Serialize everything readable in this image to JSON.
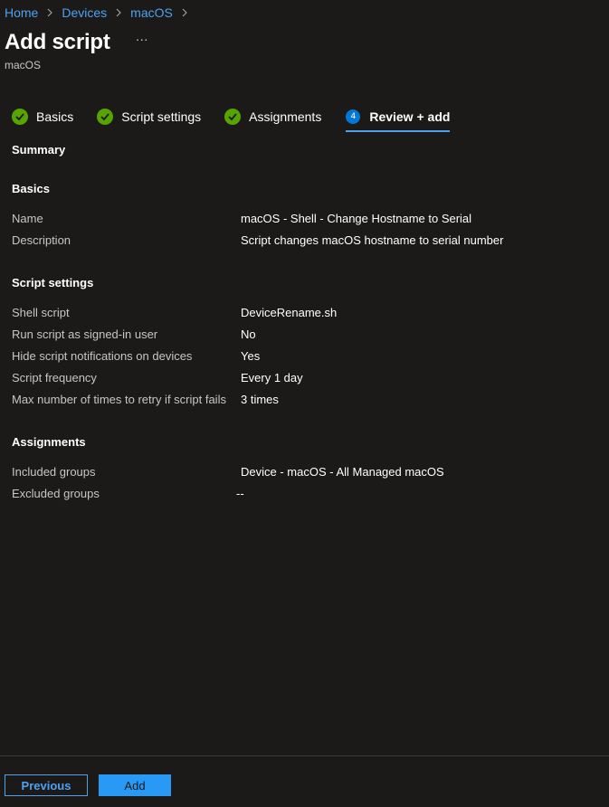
{
  "breadcrumb": {
    "items": [
      "Home",
      "Devices",
      "macOS"
    ]
  },
  "header": {
    "title": "Add script",
    "more": "···",
    "subtitle": "macOS"
  },
  "wizard": {
    "steps": [
      {
        "label": "Basics",
        "state": "complete"
      },
      {
        "label": "Script settings",
        "state": "complete"
      },
      {
        "label": "Assignments",
        "state": "complete"
      },
      {
        "label": "Review + add",
        "state": "active",
        "number": "4"
      }
    ]
  },
  "summary": {
    "heading": "Summary",
    "basics": {
      "heading": "Basics",
      "rows": [
        {
          "key": "Name",
          "value": "macOS - Shell - Change Hostname to Serial"
        },
        {
          "key": "Description",
          "value": "Script changes macOS hostname to serial number"
        }
      ]
    },
    "script_settings": {
      "heading": "Script settings",
      "rows": [
        {
          "key": "Shell script",
          "value": "DeviceRename.sh"
        },
        {
          "key": "Run script as signed-in user",
          "value": "No"
        },
        {
          "key": "Hide script notifications on devices",
          "value": "Yes"
        },
        {
          "key": "Script frequency",
          "value": "Every 1 day"
        },
        {
          "key": "Max number of times to retry if script fails",
          "value": "3 times"
        }
      ]
    },
    "assignments": {
      "heading": "Assignments",
      "rows": [
        {
          "key": "Included groups",
          "value": "Device - macOS - All Managed macOS"
        },
        {
          "key": "Excluded groups",
          "value": "--"
        }
      ]
    }
  },
  "footer": {
    "previous_label": "Previous",
    "add_label": "Add"
  },
  "colors": {
    "background": "#1b1a19",
    "link": "#4ea1f0",
    "step_complete": "#57a300",
    "step_active": "#0078d4",
    "primary_button": "#2899f5"
  }
}
